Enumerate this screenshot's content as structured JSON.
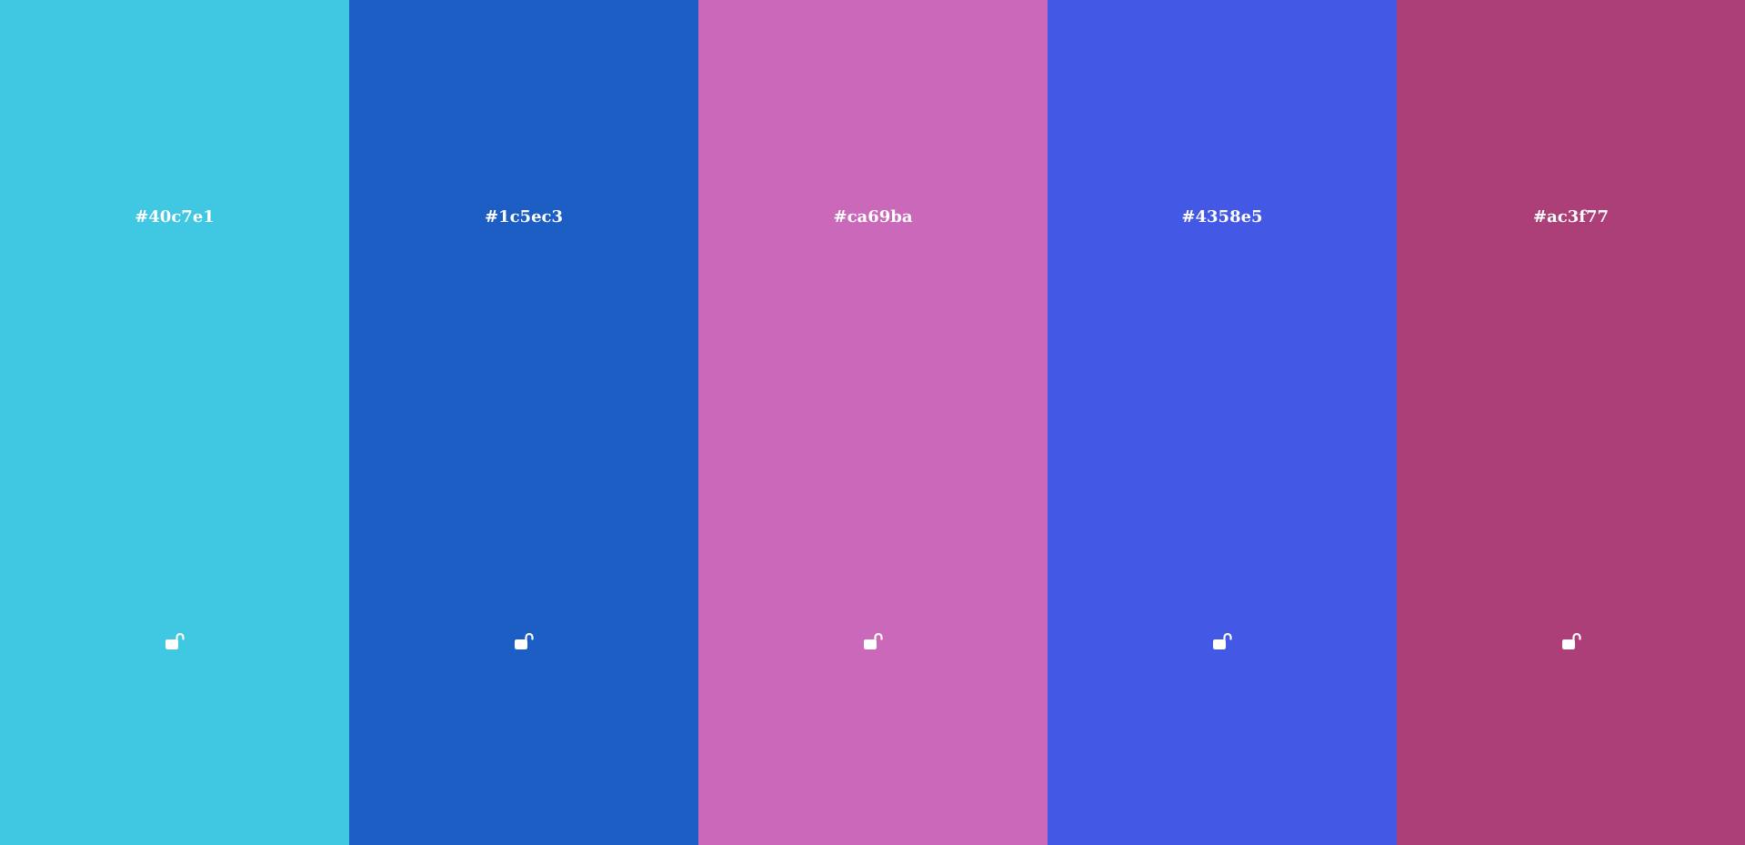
{
  "palette": {
    "swatches": [
      {
        "hex": "#40c7e1",
        "color": "#40c7e1",
        "lock_icon": "unlock-icon",
        "locked": false
      },
      {
        "hex": "#1c5ec3",
        "color": "#1c5ec3",
        "lock_icon": "unlock-icon",
        "locked": false
      },
      {
        "hex": "#ca69ba",
        "color": "#ca69ba",
        "lock_icon": "unlock-icon",
        "locked": false
      },
      {
        "hex": "#4358e5",
        "color": "#4358e5",
        "lock_icon": "unlock-icon",
        "locked": false
      },
      {
        "hex": "#ac3f77",
        "color": "#ac3f77",
        "lock_icon": "unlock-icon",
        "locked": false
      }
    ],
    "icon_color": "#ffffff",
    "text_color": "#ffffff"
  }
}
